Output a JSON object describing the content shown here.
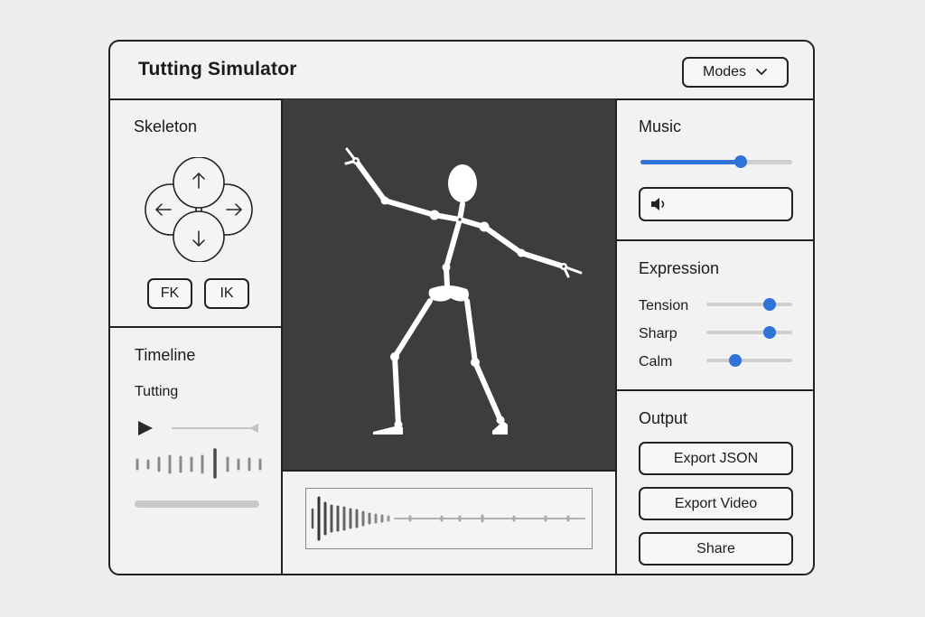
{
  "app": {
    "title": "Tutting Simulator",
    "modes_label": "Modes"
  },
  "skeleton": {
    "title": "Skeleton",
    "fk_label": "FK",
    "ik_label": "IK"
  },
  "timeline": {
    "title": "Timeline",
    "track_name": "Tutting"
  },
  "music": {
    "title": "Music",
    "volume": 0.66
  },
  "expression": {
    "title": "Expression",
    "sliders": [
      {
        "label": "Tension",
        "value": 0.74
      },
      {
        "label": "Sharp",
        "value": 0.74
      },
      {
        "label": "Calm",
        "value": 0.34
      }
    ]
  },
  "output": {
    "title": "Output",
    "export_json_label": "Export JSON",
    "export_video_label": "Export Video",
    "share_label": "Share"
  },
  "colors": {
    "accent": "#2f73d9",
    "stage": "#3d3d3d",
    "border": "#222222"
  }
}
